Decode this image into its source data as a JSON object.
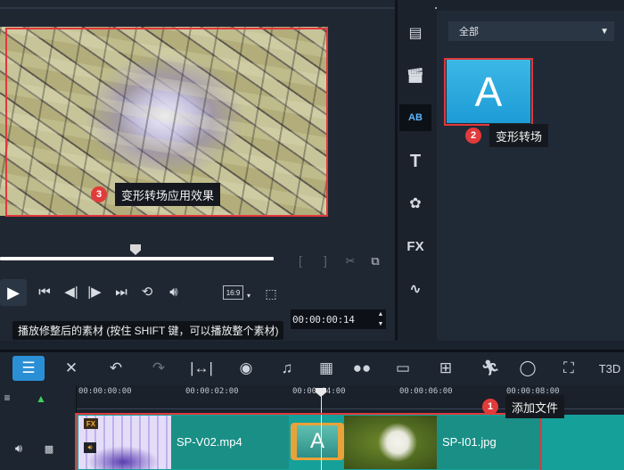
{
  "preview": {
    "step3_badge": "3",
    "step3_tooltip": "变形转场应用效果",
    "aspect_ratio": "16:9",
    "timecode": "00:00:00:14",
    "hint": "播放修整后的素材 (按住 SHIFT 键，可以播放整个素材)"
  },
  "library": {
    "filter_value": "全部",
    "thumbnail_letter": "A",
    "step2_badge": "2",
    "step2_tooltip": "变形转场",
    "tool_icons": [
      "media-icon",
      "instant-project-icon",
      "transition-icon",
      "title-icon",
      "graphics-icon",
      "filter-icon",
      "path-icon"
    ],
    "tool_fx_label": "FX",
    "tool_title_label": "T",
    "tool_transition_label": "AB"
  },
  "timeline": {
    "ruler_ticks": [
      "00:00:00:00",
      "00:00:02:00",
      "00:00:04:00",
      "00:00:06:00",
      "00:00:08:00"
    ],
    "clips": [
      {
        "name": "SP-V02.mp4",
        "fx_badge": "FX"
      },
      {
        "name": "SP-I01.jpg"
      }
    ],
    "transition_letter": "A",
    "step1_badge": "1",
    "step1_tooltip": "添加文件",
    "toolbar_label_3d": "T3D"
  },
  "colors": {
    "highlight": "#e0383c",
    "badge": "#e23b3b",
    "track": "#16a09a",
    "accent": "#2b8fd6"
  }
}
